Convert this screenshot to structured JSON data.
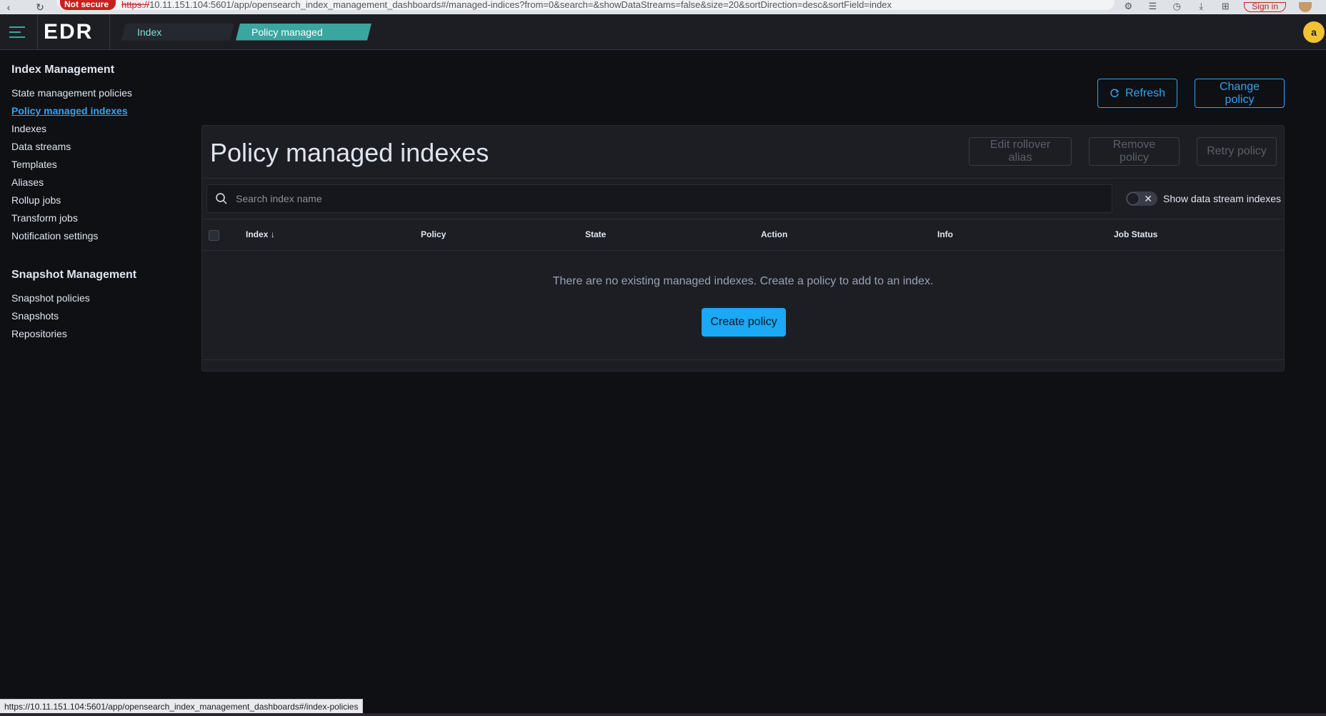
{
  "browser": {
    "not_secure_label": "Not secure",
    "url_scheme": "https://",
    "url_rest": "10.11.151.104:5601/app/opensearch_index_management_dashboards#/managed-indices?from=0&search=&showDataStreams=false&size=20&sortDirection=desc&sortField=index",
    "signin_label": "Sign in"
  },
  "header": {
    "logo": "EDR",
    "breadcrumbs": [
      "Index Manageme...",
      "Policy managed indexes"
    ],
    "avatar_letter": "a"
  },
  "sidebar": {
    "index_section_title": "Index Management",
    "index_items": [
      {
        "label": "State management policies",
        "active": false
      },
      {
        "label": "Policy managed indexes",
        "active": true
      },
      {
        "label": "Indexes",
        "active": false
      },
      {
        "label": "Data streams",
        "active": false
      },
      {
        "label": "Templates",
        "active": false
      },
      {
        "label": "Aliases",
        "active": false
      },
      {
        "label": "Rollup jobs",
        "active": false
      },
      {
        "label": "Transform jobs",
        "active": false
      },
      {
        "label": "Notification settings",
        "active": false
      }
    ],
    "snapshot_section_title": "Snapshot Management",
    "snapshot_items": [
      {
        "label": "Snapshot policies"
      },
      {
        "label": "Snapshots"
      },
      {
        "label": "Repositories"
      }
    ]
  },
  "top_actions": {
    "refresh_label": "Refresh",
    "change_policy_label": "Change policy"
  },
  "panel": {
    "title": "Policy managed indexes",
    "edit_rollover_alias_label": "Edit rollover alias",
    "remove_policy_label": "Remove policy",
    "retry_policy_label": "Retry policy",
    "search_placeholder": "Search index name",
    "toggle_label": "Show data stream indexes",
    "toggle_on": false,
    "columns": [
      "Index",
      "Policy",
      "State",
      "Action",
      "Info",
      "Job Status"
    ],
    "sort_indicator": "↓",
    "empty_message": "There are no existing managed indexes. Create a policy to add to an index.",
    "create_policy_label": "Create policy"
  },
  "status_bar": {
    "hover_url": "https://10.11.151.104:5601/app/opensearch_index_management_dashboards#/index-policies"
  },
  "colors": {
    "accent": "#36a2ef",
    "primary_button": "#1ba9f5",
    "breadcrumb_active": "#3aa6a0",
    "background": "#0f1014",
    "panel": "#1d1e24"
  }
}
